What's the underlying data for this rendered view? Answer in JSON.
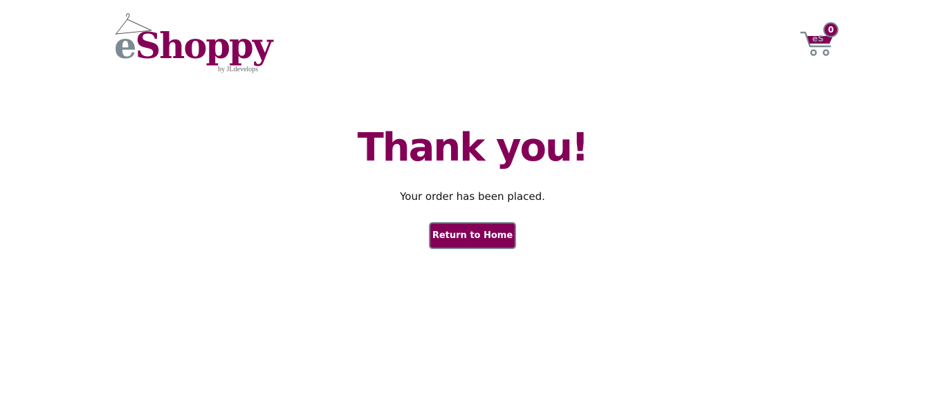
{
  "header": {
    "logo": {
      "e_text": "e",
      "brand_text": "Shoppy",
      "byline": "by JLdevelops"
    },
    "cart": {
      "brand_text": "eS",
      "count": "0"
    }
  },
  "main": {
    "title": "Thank you!",
    "message": "Your order has been placed.",
    "return_button_label": "Return to Home"
  },
  "colors": {
    "primary": "#840057",
    "secondary": "#7c8a93",
    "background": "#ffffff"
  },
  "icons": {
    "logo_hanger": "hanger-icon",
    "cart": "shopping-cart-icon"
  }
}
